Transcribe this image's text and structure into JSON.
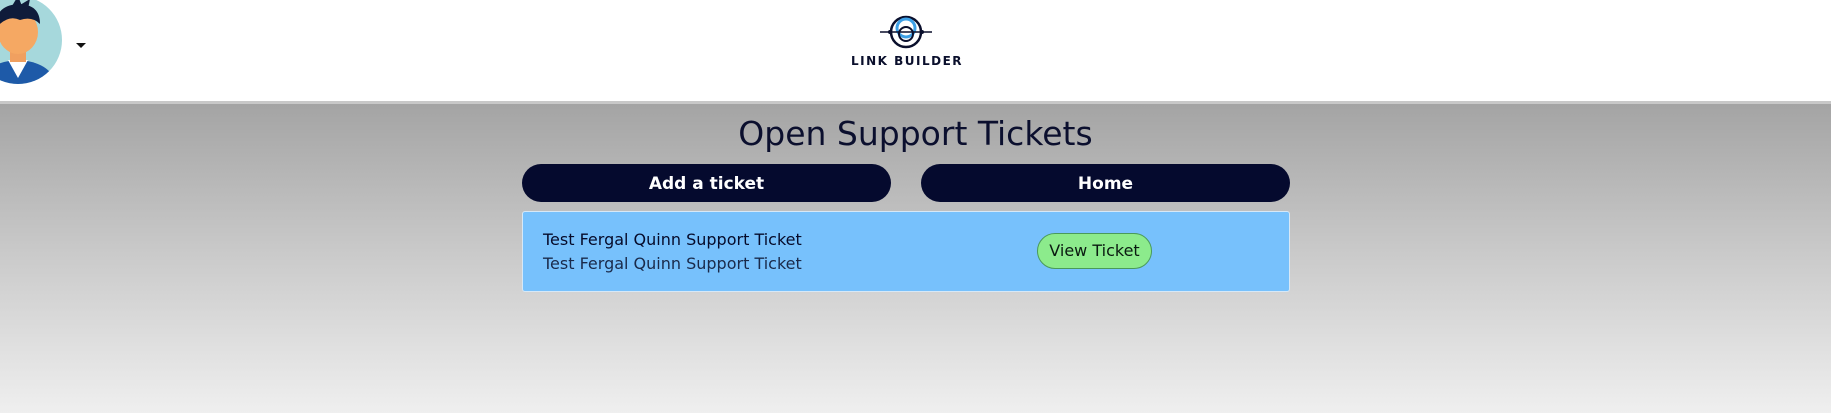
{
  "header": {
    "logo_text": "LINK BUILDER",
    "avatar_icon": "user-avatar",
    "menu_icon": "caret-down-icon"
  },
  "main": {
    "title": "Open Support Tickets",
    "add_ticket_label": "Add a ticket",
    "home_label": "Home"
  },
  "tickets": [
    {
      "title": "Test Fergal Quinn Support Ticket",
      "description": "Test Fergal Quinn Support Ticket",
      "view_label": "View Ticket"
    }
  ],
  "colors": {
    "navy": "#050a2e",
    "ticket_bg": "#77c1fc",
    "view_button": "#8ceb8c"
  }
}
